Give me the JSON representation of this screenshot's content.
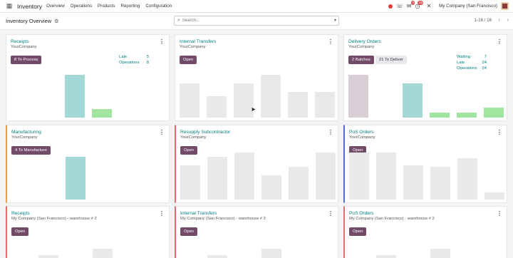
{
  "topbar": {
    "app_name": "Inventory",
    "menus": [
      "Overview",
      "Operations",
      "Products",
      "Reporting",
      "Configuration"
    ],
    "activity_count": "4",
    "message_count": "15",
    "company": "My Company (San Francisco)"
  },
  "control": {
    "breadcrumb": "Inventory Overview",
    "search_placeholder": "Search...",
    "pager": "1-16 / 16"
  },
  "cards": [
    {
      "title": "Receipts",
      "subtitle": "YourCompany",
      "primary": "8 To Process",
      "stats": [
        {
          "label": "Late",
          "value": "5"
        },
        {
          "label": "Operations",
          "value": "8"
        }
      ],
      "bars": [
        0,
        0,
        5,
        1,
        0,
        0
      ]
    },
    {
      "title": "Internal Transfers",
      "subtitle": "YourCompany",
      "primary": "Open",
      "bars": [
        4,
        2.5,
        4,
        5,
        3,
        3
      ]
    },
    {
      "title": "Delivery Orders",
      "subtitle": "YourCompany",
      "primary": "2 Batches",
      "secondary": "21 To Deliver",
      "stats": [
        {
          "label": "Waiting",
          "value": "7"
        },
        {
          "label": "Late",
          "value": "24"
        },
        {
          "label": "Operations",
          "value": "24"
        }
      ],
      "bars": [
        5,
        0,
        4,
        0.6,
        0.6,
        1.2
      ]
    },
    {
      "title": "Manufacturing",
      "subtitle": "YourCompany",
      "primary": "4 To Manufacture",
      "bars": [
        0,
        0,
        5,
        0,
        0,
        0
      ]
    },
    {
      "title": "Resupply Subcontractor",
      "subtitle": "YourCompany",
      "primary": "Open",
      "bars": [
        4,
        5,
        5.5,
        2.8,
        3.8,
        5.5
      ]
    },
    {
      "title": "PoS Orders",
      "subtitle": "YourCompany",
      "primary": "Open",
      "bars": [
        5.5,
        5.5,
        4,
        3.8,
        4.8,
        0.8
      ]
    },
    {
      "title": "Receipts",
      "subtitle": "My Company (San Francisco) - warehouse # 2",
      "primary": "Open",
      "bars": [
        1,
        2,
        1.5,
        3,
        1,
        1
      ]
    },
    {
      "title": "Internal Transfers",
      "subtitle": "My Company (San Francisco) - warehouse # 2",
      "primary": "Open",
      "bars": [
        1,
        2,
        1.5,
        3,
        1,
        1
      ]
    },
    {
      "title": "PoS Orders",
      "subtitle": "My Company (San Francisco) - warehouse # 2",
      "primary": "Open",
      "bars": [
        1,
        2,
        1.5,
        3,
        1,
        1
      ]
    }
  ]
}
